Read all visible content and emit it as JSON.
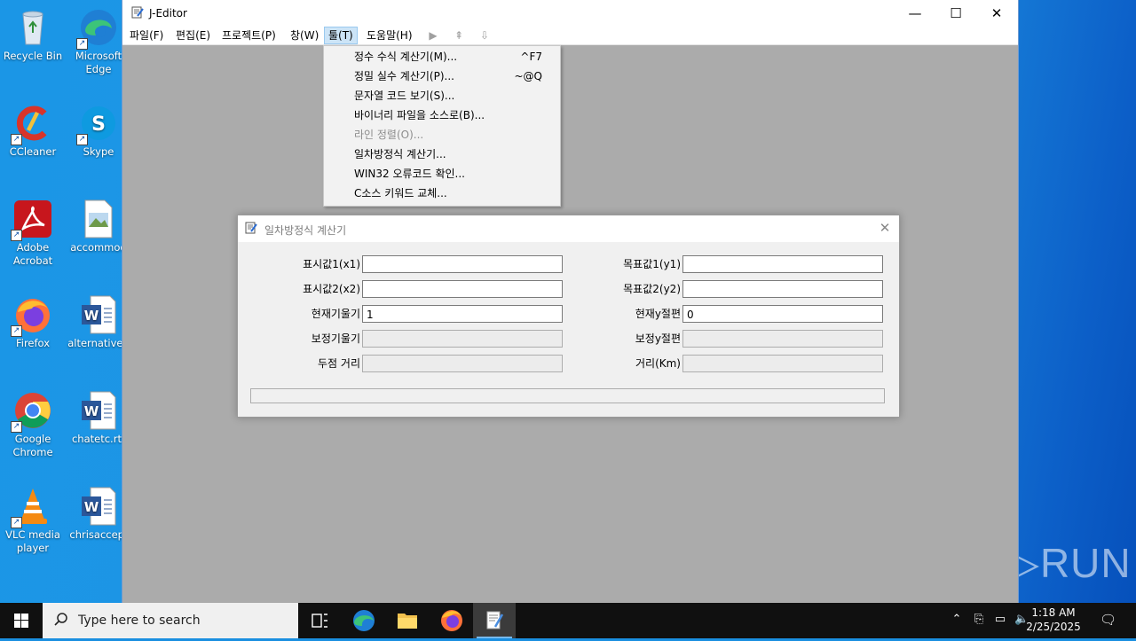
{
  "desktop": {
    "icons": [
      {
        "label": "Recycle Bin",
        "icon": "recycle-bin-icon"
      },
      {
        "label": "Microsoft Edge",
        "icon": "edge-icon"
      },
      {
        "label": "CCleaner",
        "icon": "ccleaner-icon"
      },
      {
        "label": "Skype",
        "icon": "skype-icon"
      },
      {
        "label": "Adobe Acrobat",
        "icon": "acrobat-icon"
      },
      {
        "label": "accommod",
        "icon": "image-file-icon"
      },
      {
        "label": "Firefox",
        "icon": "firefox-icon"
      },
      {
        "label": "alternativeu",
        "icon": "word-doc-icon"
      },
      {
        "label": "Google Chrome",
        "icon": "chrome-icon"
      },
      {
        "label": "chatetc.rtf",
        "icon": "word-doc-icon"
      },
      {
        "label": "VLC media player",
        "icon": "vlc-icon"
      },
      {
        "label": "chrisaccep.",
        "icon": "word-doc-icon"
      }
    ]
  },
  "window": {
    "title": "J-Editor",
    "controls": {
      "minimize": "—",
      "maximize": "☐",
      "close": "✕"
    }
  },
  "menubar": {
    "items": [
      "파일(F)",
      "편집(E)",
      "프로젝트(P)",
      "창(W)",
      "툴(T)",
      "도움말(H)"
    ],
    "active_index": 4
  },
  "tools_menu": {
    "items": [
      {
        "label": "정수 수식 계산기(M)...",
        "shortcut": "^F7",
        "enabled": true
      },
      {
        "label": "정밀 실수 계산기(P)...",
        "shortcut": "~@Q",
        "enabled": true
      },
      {
        "label": "문자열 코드 보기(S)...",
        "shortcut": "",
        "enabled": true
      },
      {
        "label": "바이너리 파일을 소스로(B)...",
        "shortcut": "",
        "enabled": true
      },
      {
        "label": "라인 정렬(O)...",
        "shortcut": "",
        "enabled": false
      },
      {
        "label": "일차방정식 계산기...",
        "shortcut": "",
        "enabled": true
      },
      {
        "label": "WIN32 오류코드 확인...",
        "shortcut": "",
        "enabled": true
      },
      {
        "label": "C소스 키워드 교체...",
        "shortcut": "",
        "enabled": true
      }
    ]
  },
  "dialog": {
    "title": "일차방정식 계산기",
    "close": "✕",
    "left_fields": [
      {
        "label": "표시값1(x1)",
        "value": "",
        "readonly": false
      },
      {
        "label": "표시값2(x2)",
        "value": "",
        "readonly": false
      },
      {
        "label": "현재기울기",
        "value": "1",
        "readonly": false
      },
      {
        "label": "보정기울기",
        "value": "",
        "readonly": true
      },
      {
        "label": "두점 거리",
        "value": "",
        "readonly": true
      }
    ],
    "right_fields": [
      {
        "label": "목표값1(y1)",
        "value": "",
        "readonly": false
      },
      {
        "label": "목표값2(y2)",
        "value": "",
        "readonly": false
      },
      {
        "label": "현재y절편",
        "value": "0",
        "readonly": false
      },
      {
        "label": "보정y절편",
        "value": "",
        "readonly": true
      },
      {
        "label": "거리(Km)",
        "value": "",
        "readonly": true
      }
    ],
    "status": ""
  },
  "taskbar": {
    "search_placeholder": "Type here to search",
    "apps": [
      "task-view-icon",
      "edge-icon",
      "file-explorer-icon",
      "firefox-icon",
      "jeditor-icon"
    ],
    "time": "1:18 AM",
    "date": "2/25/2025"
  },
  "watermark": "ANY▷RUN",
  "colors": {
    "desktop": "#1b96e6",
    "menu_highlight": "#cce4f7",
    "taskbar": "#101010",
    "app_bg": "#ababab"
  }
}
